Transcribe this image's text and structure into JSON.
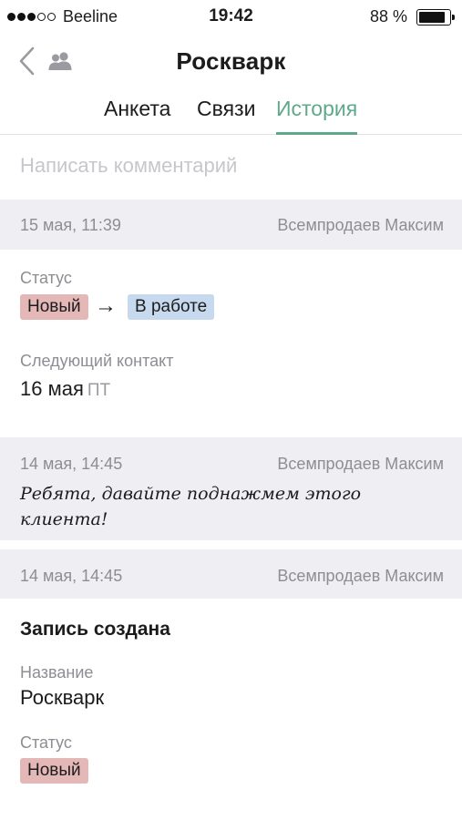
{
  "status_bar": {
    "carrier": "Beeline",
    "time": "19:42",
    "battery": "88 %",
    "battery_level": 0.88,
    "signal_strength": 3,
    "signal_max": 5
  },
  "nav": {
    "title": "Роскварк",
    "back_icon": "chevron-left-icon",
    "people_icon": "people-icon"
  },
  "tabs": [
    {
      "label": "Анкета",
      "active": false
    },
    {
      "label": "Связи",
      "active": false
    },
    {
      "label": "История",
      "active": true
    }
  ],
  "comment": {
    "placeholder": "Написать комментарий"
  },
  "history": [
    {
      "date": "15 мая, 11:39",
      "author": "Всемпродаев Максим",
      "status_label": "Статус",
      "status_from": "Новый",
      "status_to": "В работе",
      "next_contact_label": "Следующий контакт",
      "next_contact_date": "16 мая",
      "next_contact_weekday": "ПТ"
    },
    {
      "date": "14 мая, 14:45",
      "author": "Всемпродаев Максим",
      "comment": "Ребята, давайте поднажмем этого клиента!"
    },
    {
      "date": "14 мая, 14:45",
      "author": "Всемпродаев Максим",
      "heading": "Запись создана",
      "name_label": "Название",
      "name_value": "Роскварк",
      "status_label": "Статус",
      "status_value": "Новый"
    }
  ],
  "colors": {
    "accent": "#5ea88c",
    "header_bg": "#efeef3",
    "badge_new": "#e5b8b8",
    "badge_work": "#c7d9ee"
  }
}
